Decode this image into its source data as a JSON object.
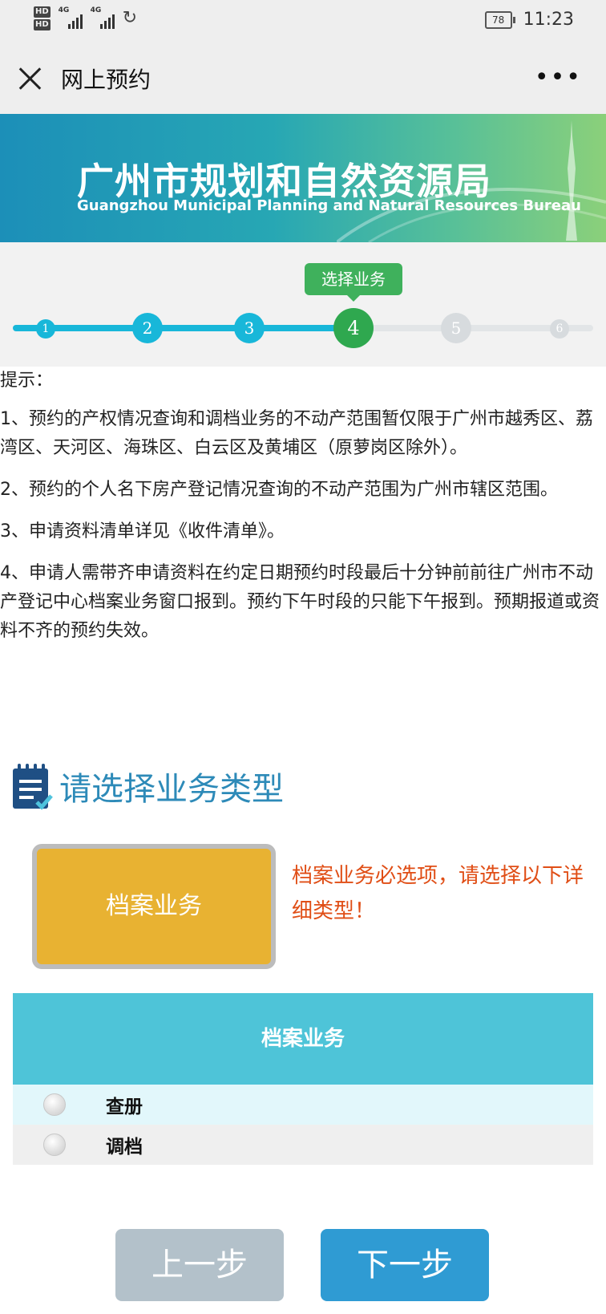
{
  "status_bar": {
    "network_top": "4G",
    "network_bottom": "4G",
    "battery": "78",
    "time": "11:23"
  },
  "nav": {
    "title": "网上预约"
  },
  "banner": {
    "title": "广州市规划和自然资源局",
    "subtitle": "Guangzhou Municipal Planning and Natural Resources Bureau"
  },
  "stepper": {
    "tooltip": "选择业务",
    "steps": [
      "1",
      "2",
      "3",
      "4",
      "5",
      "6"
    ],
    "current": 4,
    "colors": {
      "done": "#18b7d9",
      "current": "#2fa84f",
      "pending": "#d7dbde"
    }
  },
  "tips": {
    "heading": "提示：",
    "items": [
      "1、预约的产权情况查询和调档业务的不动产范围暂仅限于广州市越秀区、荔湾区、天河区、海珠区、白云区及黄埔区（原萝岗区除外）。",
      "2、预约的个人名下房产登记情况查询的不动产范围为广州市辖区范围。",
      "3、申请资料清单详见《收件清单》。",
      "4、申请人需带齐申请资料在约定日期预约时段最后十分钟前前往广州市不动产登记中心档案业务窗口报到。预约下午时段的只能下午报到。预期报道或资料不齐的预约失效。"
    ]
  },
  "section": {
    "title": "请选择业务类型"
  },
  "archive": {
    "tile_label": "档案业务",
    "note": "档案业务必选项，请选择以下详细类型！",
    "table_header": "档案业务",
    "options": [
      "查册",
      "调档"
    ]
  },
  "buttons": {
    "prev": "上一步",
    "next": "下一步"
  }
}
